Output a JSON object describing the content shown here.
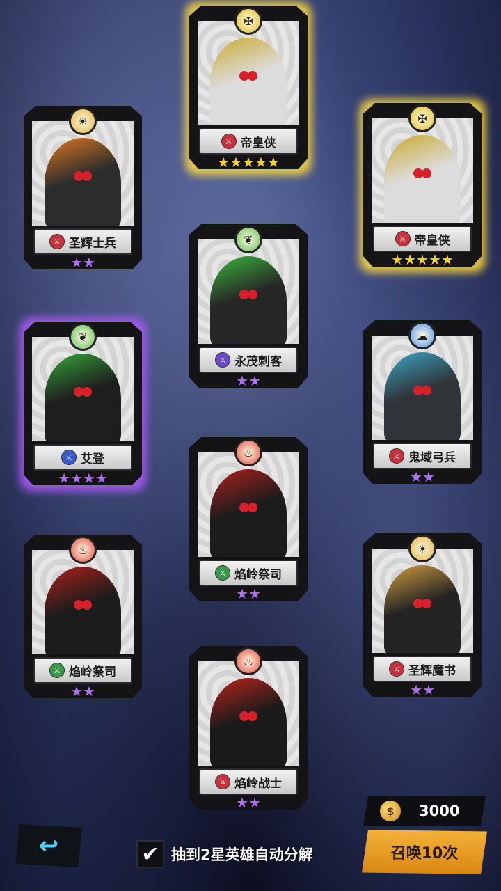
{
  "colors": {
    "gold_glow": "#ffdc3c",
    "purple_glow": "#af5aff",
    "star_gold": "#ffd21e",
    "star_purple": "#b06cff",
    "summon_button": "#e9a024",
    "back_arrow": "#4fd2f0"
  },
  "cards": [
    {
      "name": "帝皇侠",
      "stars": "★★★★★",
      "star_color": "#ffd21e",
      "glow": "gold",
      "emblem_icon": "holy-emblem-icon",
      "emblem_glyph": "✠",
      "emblem_color": "#e8d060",
      "class_icon": "sword-class-icon",
      "class_color": "#c8323c",
      "figure_color": "#dcdcdc",
      "accent": "#caa92a"
    },
    {
      "name": "圣辉士兵",
      "stars": "★★",
      "star_color": "#b06cff",
      "glow": "none",
      "emblem_icon": "sun-emblem-icon",
      "emblem_glyph": "☀",
      "emblem_color": "#e8c770",
      "class_icon": "sword-class-icon",
      "class_color": "#c8323c",
      "figure_color": "#2c2c2c",
      "accent": "#e07820"
    },
    {
      "name": "帝皇侠",
      "stars": "★★★★★",
      "star_color": "#ffd21e",
      "glow": "gold",
      "emblem_icon": "holy-emblem-icon",
      "emblem_glyph": "✠",
      "emblem_color": "#e8d060",
      "class_icon": "sword-class-icon",
      "class_color": "#c8323c",
      "figure_color": "#dcdcdc",
      "accent": "#caa92a"
    },
    {
      "name": "永茂刺客",
      "stars": "★★",
      "star_color": "#b06cff",
      "glow": "none",
      "emblem_icon": "leaf-emblem-icon",
      "emblem_glyph": "❦",
      "emblem_color": "#8fd080",
      "class_icon": "dagger-class-icon",
      "class_color": "#6a4ac8",
      "figure_color": "#262626",
      "accent": "#3cb83c"
    },
    {
      "name": "艾登",
      "stars": "★★★★",
      "star_color": "#b06cff",
      "glow": "purple",
      "emblem_icon": "leaf-emblem-icon",
      "emblem_glyph": "❦",
      "emblem_color": "#8fd080",
      "class_icon": "swirl-class-icon",
      "class_color": "#3a5ad0",
      "figure_color": "#1e1e1e",
      "accent": "#36a83a"
    },
    {
      "name": "鬼域弓兵",
      "stars": "★★",
      "star_color": "#b06cff",
      "glow": "none",
      "emblem_icon": "water-emblem-icon",
      "emblem_glyph": "☁",
      "emblem_color": "#80b0e8",
      "class_icon": "sword-class-icon",
      "class_color": "#c8323c",
      "figure_color": "#303438",
      "accent": "#3aa6c8"
    },
    {
      "name": "焰岭祭司",
      "stars": "★★",
      "star_color": "#b06cff",
      "glow": "none",
      "emblem_icon": "flame-emblem-icon",
      "emblem_glyph": "♨",
      "emblem_color": "#e88070",
      "class_icon": "staff-class-icon",
      "class_color": "#3a9a4a",
      "figure_color": "#1c1c1c",
      "accent": "#b0201c"
    },
    {
      "name": "焰岭祭司",
      "stars": "★★",
      "star_color": "#b06cff",
      "glow": "none",
      "emblem_icon": "flame-emblem-icon",
      "emblem_glyph": "♨",
      "emblem_color": "#e88070",
      "class_icon": "staff-class-icon",
      "class_color": "#3a9a4a",
      "figure_color": "#1c1c1c",
      "accent": "#b0201c"
    },
    {
      "name": "圣辉魔书",
      "stars": "★★",
      "star_color": "#b06cff",
      "glow": "none",
      "emblem_icon": "sun-emblem-icon",
      "emblem_glyph": "☀",
      "emblem_color": "#e8c770",
      "class_icon": "sword-class-icon",
      "class_color": "#c8323c",
      "figure_color": "#242424",
      "accent": "#d4a040"
    },
    {
      "name": "焰岭战士",
      "stars": "★★",
      "star_color": "#b06cff",
      "glow": "none",
      "emblem_icon": "flame-emblem-icon",
      "emblem_glyph": "♨",
      "emblem_color": "#e88070",
      "class_icon": "sword-class-icon",
      "class_color": "#c8323c",
      "figure_color": "#1a1a1a",
      "accent": "#c0241c"
    }
  ],
  "bottom": {
    "back_icon": "return-arrow-icon",
    "back_glyph": "↩",
    "auto_checked": true,
    "check_glyph": "✔",
    "auto_label": "抽到2星英雄自动分解",
    "currency_icon": "summon-token-icon",
    "currency_glyph": "$",
    "currency_amount": "3000",
    "summon_label": "召唤10次"
  }
}
